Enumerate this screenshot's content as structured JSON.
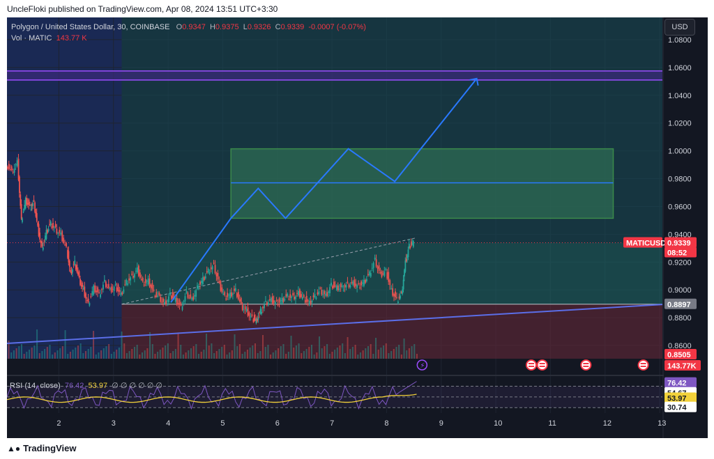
{
  "publisher_line": "UncleFloki published on TradingView.com, Apr 08, 2024 13:51 UTC+3:30",
  "footer": {
    "brand": "TradingView",
    "logo_icon": "tradingview-logo-icon"
  },
  "currency_button": "USD",
  "legend": {
    "symbol": "Polygon / United States Dollar, 30, COINBASE",
    "o_label": "O",
    "o_value": "0.9347",
    "h_label": "H",
    "h_value": "0.9375",
    "l_label": "L",
    "l_value": "0.9326",
    "c_label": "C",
    "c_value": "0.9339",
    "change": "-0.0007 (-0.07%)",
    "vol_label": "Vol · MATIC",
    "vol_value": "143.77 K"
  },
  "rsi_legend": {
    "label": "RSI (14, close)",
    "v1": "76.42",
    "v2": "53.97",
    "extra": "∅ ∅ ∅ ∅ ∅ ∅"
  },
  "colors": {
    "background": "#131722",
    "grid": "#1e2431",
    "bull": "#26a69a",
    "bear": "#ef5350",
    "trendline": "#5b6ee8",
    "projection": "#2979ff",
    "zone_green": "#4caf50",
    "resistance": "#9c4dff",
    "rsi_line": "#7e57c2",
    "rsi_ma": "#f2d13a"
  },
  "chart_data": {
    "type": "candlestick",
    "symbol": "Polygon / United States Dollar",
    "interval": "30",
    "exchange": "COINBASE",
    "y_axis_ticks": [
      "1.0800",
      "1.0600",
      "1.0400",
      "1.0200",
      "1.0000",
      "0.9800",
      "0.9600",
      "0.9400",
      "0.9200",
      "0.9000",
      "0.8800",
      "0.8600"
    ],
    "x_axis_ticks": [
      "2",
      "3",
      "4",
      "5",
      "6",
      "7",
      "8",
      "9",
      "10",
      "11",
      "12",
      "13"
    ],
    "ylim": [
      0.8505,
      1.096
    ],
    "xlim": [
      1.05,
      13.05
    ],
    "price_path": [
      [
        1.05,
        0.991
      ],
      [
        1.15,
        0.985
      ],
      [
        1.25,
        0.992
      ],
      [
        1.32,
        0.95
      ],
      [
        1.4,
        0.965
      ],
      [
        1.48,
        0.96
      ],
      [
        1.55,
        0.963
      ],
      [
        1.62,
        0.945
      ],
      [
        1.7,
        0.93
      ],
      [
        1.78,
        0.942
      ],
      [
        1.86,
        0.948
      ],
      [
        1.95,
        0.944
      ],
      [
        2.05,
        0.94
      ],
      [
        2.15,
        0.93
      ],
      [
        2.22,
        0.912
      ],
      [
        2.3,
        0.92
      ],
      [
        2.38,
        0.908
      ],
      [
        2.46,
        0.9
      ],
      [
        2.55,
        0.89
      ],
      [
        2.65,
        0.902
      ],
      [
        2.75,
        0.897
      ],
      [
        2.85,
        0.906
      ],
      [
        2.95,
        0.9
      ],
      [
        3.05,
        0.903
      ],
      [
        3.15,
        0.897
      ],
      [
        3.25,
        0.906
      ],
      [
        3.35,
        0.91
      ],
      [
        3.45,
        0.915
      ],
      [
        3.55,
        0.905
      ],
      [
        3.65,
        0.907
      ],
      [
        3.75,
        0.898
      ],
      [
        3.85,
        0.895
      ],
      [
        3.95,
        0.89
      ],
      [
        4.05,
        0.897
      ],
      [
        4.15,
        0.893
      ],
      [
        4.25,
        0.888
      ],
      [
        4.35,
        0.898
      ],
      [
        4.45,
        0.893
      ],
      [
        4.55,
        0.902
      ],
      [
        4.65,
        0.908
      ],
      [
        4.75,
        0.914
      ],
      [
        4.85,
        0.918
      ],
      [
        4.95,
        0.904
      ],
      [
        5.05,
        0.895
      ],
      [
        5.15,
        0.897
      ],
      [
        5.25,
        0.9
      ],
      [
        5.35,
        0.889
      ],
      [
        5.45,
        0.885
      ],
      [
        5.55,
        0.88
      ],
      [
        5.62,
        0.878
      ],
      [
        5.7,
        0.885
      ],
      [
        5.8,
        0.891
      ],
      [
        5.9,
        0.893
      ],
      [
        6.0,
        0.891
      ],
      [
        6.1,
        0.893
      ],
      [
        6.2,
        0.896
      ],
      [
        6.3,
        0.895
      ],
      [
        6.4,
        0.898
      ],
      [
        6.5,
        0.894
      ],
      [
        6.6,
        0.891
      ],
      [
        6.7,
        0.896
      ],
      [
        6.8,
        0.9
      ],
      [
        6.9,
        0.896
      ],
      [
        7.0,
        0.904
      ],
      [
        7.1,
        0.902
      ],
      [
        7.2,
        0.902
      ],
      [
        7.3,
        0.904
      ],
      [
        7.4,
        0.905
      ],
      [
        7.5,
        0.903
      ],
      [
        7.6,
        0.906
      ],
      [
        7.7,
        0.912
      ],
      [
        7.8,
        0.922
      ],
      [
        7.9,
        0.911
      ],
      [
        8.0,
        0.914
      ],
      [
        8.1,
        0.9
      ],
      [
        8.2,
        0.893
      ],
      [
        8.28,
        0.897
      ],
      [
        8.35,
        0.92
      ],
      [
        8.42,
        0.932
      ],
      [
        8.5,
        0.9339
      ]
    ],
    "last_price": 0.9339,
    "price_label": "MATICUSD",
    "price_value": "0.9339",
    "countdown": "08:52",
    "support_level_label": "0.8897",
    "support_level": 0.8897,
    "lower_level_label": "0.8505",
    "lower_level": 0.8505,
    "volume_label": "143.77K",
    "drawings": {
      "long_position_box": {
        "x_start": 3.15,
        "x_end": 13.05,
        "entry": 0.8897,
        "target": 0.9339,
        "stop": 0.8505
      },
      "accumulation_box": {
        "x_start": 5.15,
        "x_end": 12.15,
        "top": 1.0015,
        "bottom": 0.9515,
        "mid": 0.977
      },
      "resistance_band": {
        "top": 1.0575,
        "bottom": 1.051
      },
      "rising_trendline": [
        [
          1.05,
          0.8615
        ],
        [
          13.05,
          0.8895
        ]
      ],
      "dashed_channel": [
        [
          3.15,
          0.8897
        ],
        [
          8.55,
          0.9375
        ]
      ],
      "projection_path": [
        [
          4.05,
          0.891
        ],
        [
          5.15,
          0.9515
        ],
        [
          5.65,
          0.973
        ],
        [
          6.15,
          0.9515
        ],
        [
          7.3,
          1.0015
        ],
        [
          8.15,
          0.978
        ],
        [
          9.65,
          1.052
        ]
      ]
    },
    "rsi": {
      "label": "RSI (14, close)",
      "value": "76.42",
      "ma_value": "53.97",
      "levels_labels": [
        "54.67",
        "30.74"
      ],
      "ylim": [
        20,
        85
      ]
    },
    "event_icons": [
      "us-flag-icon",
      "us-flag-icon",
      "us-flag-icon",
      "us-flag-icon",
      "us-flag-icon"
    ],
    "lightning_icon": "lightning-icon"
  }
}
